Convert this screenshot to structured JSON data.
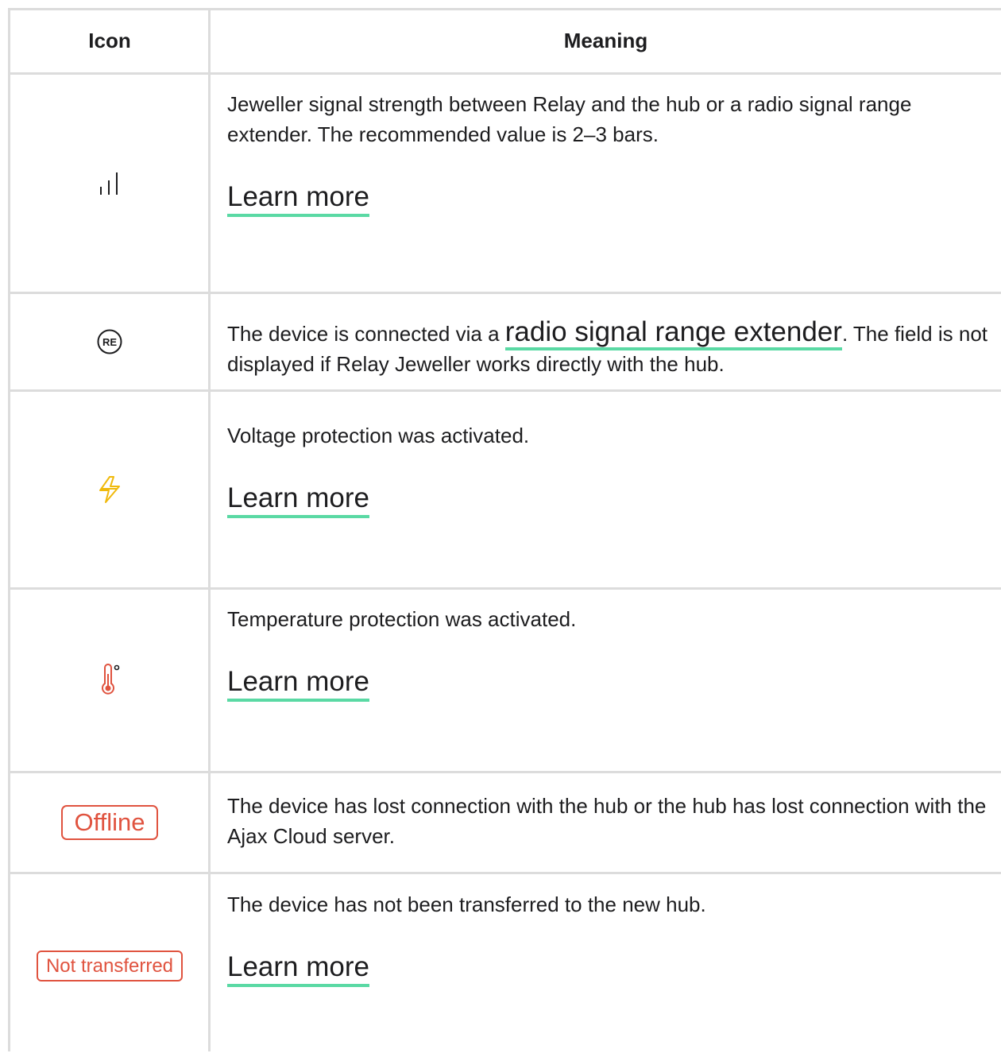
{
  "header": {
    "icon_col": "Icon",
    "meaning_col": "Meaning"
  },
  "rows": [
    {
      "icon": "signal-strength-icon",
      "text": "Jeweller signal strength between Relay and the hub or a radio signal range extender. The recommended value is 2–3 bars.",
      "link": "Learn more"
    },
    {
      "icon": "range-extender-icon",
      "icon_text": "RE",
      "text_before": "The device is connected via a ",
      "link": "radio signal range extender",
      "text_after": ". The field is not displayed if Relay Jeweller works directly with the hub."
    },
    {
      "icon": "voltage-protection-icon",
      "icon_color": "#f0b90b",
      "text": "Voltage protection was activated.",
      "link": "Learn more"
    },
    {
      "icon": "temperature-protection-icon",
      "icon_color": "#e0533f",
      "text": "Temperature protection was activated.",
      "link": "Learn more"
    },
    {
      "icon": "offline-badge",
      "badge": "Offline",
      "badge_color": "#e0533f",
      "text": "The device has lost connection with the hub or the hub has lost connection with the Ajax Cloud server."
    },
    {
      "icon": "not-transferred-badge",
      "badge": "Not transferred",
      "badge_color": "#e0533f",
      "text": "The device has not been transferred to the new hub.",
      "link": "Learn more"
    }
  ],
  "colors": {
    "link_underline": "#5ad9a4",
    "grid": "#dcdcdc",
    "alert": "#e0533f",
    "warning": "#f0b90b"
  }
}
